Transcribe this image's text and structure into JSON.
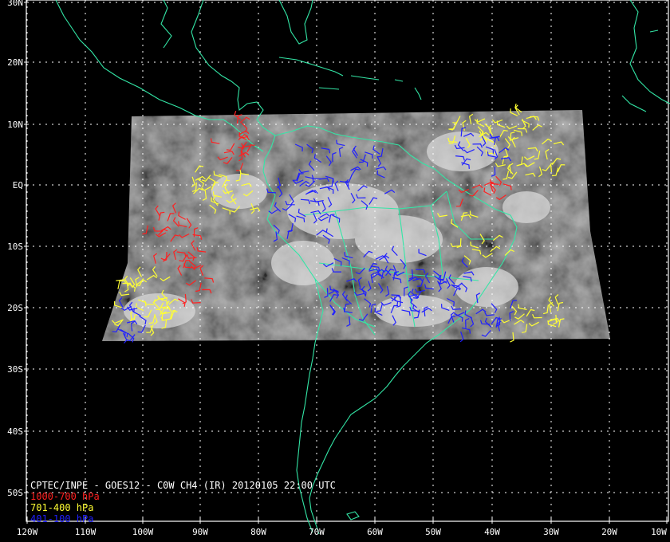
{
  "map": {
    "title": "CPTEC/INPE - GOES12 - C0W CH4 (IR) 20120105 22:00 UTC",
    "lat_labels": [
      "30N",
      "20N",
      "10N",
      "EQ",
      "10S",
      "20S",
      "30S",
      "40S",
      "50S"
    ],
    "lon_labels": [
      "120W",
      "110W",
      "100W",
      "90W",
      "80W",
      "70W",
      "60W",
      "50W",
      "40W",
      "30W",
      "20W",
      "10W"
    ],
    "legend": [
      {
        "label": "1000-700 hPa",
        "color": "#ff2020"
      },
      {
        "label": "701-400 hPa",
        "color": "#ffff33"
      },
      {
        "label": "401-100 hPa",
        "color": "#2020ff"
      }
    ],
    "coastline_color": "#33e6a6",
    "grid_color": "#ffffff",
    "background_color": "#000000"
  }
}
